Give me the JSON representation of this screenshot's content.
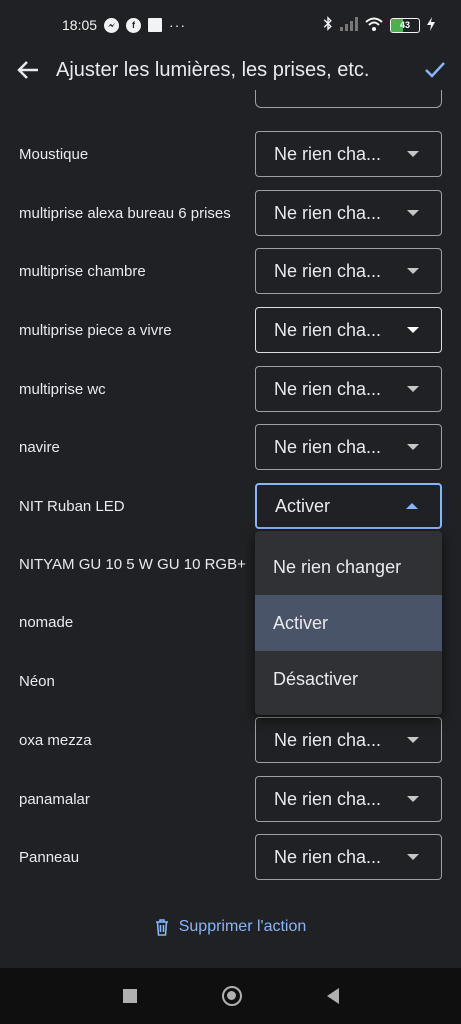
{
  "status_bar": {
    "time": "18:05",
    "dots": "···",
    "battery_level": "43",
    "battery_percent": 43
  },
  "header": {
    "title": "Ajuster les lumières, les prises, etc."
  },
  "devices": [
    {
      "label": "Moustique",
      "value": "Ne rien cha..."
    },
    {
      "label": "multiprise alexa bureau 6 prises",
      "value": "Ne rien cha..."
    },
    {
      "label": "multiprise chambre",
      "value": "Ne rien cha..."
    },
    {
      "label": "multiprise piece a vivre",
      "value": "Ne rien cha..."
    },
    {
      "label": "multiprise wc",
      "value": "Ne rien cha..."
    },
    {
      "label": "navire",
      "value": "Ne rien cha..."
    },
    {
      "label": "NIT Ruban LED",
      "value": "Activer"
    },
    {
      "label": "NITYAM GU 10 5 W GU 10 RGB+"
    },
    {
      "label": "nomade"
    },
    {
      "label": "Néon"
    },
    {
      "label": "oxa mezza",
      "value": "Ne rien cha..."
    },
    {
      "label": "panamalar",
      "value": "Ne rien cha..."
    },
    {
      "label": "Panneau",
      "value": "Ne rien cha..."
    }
  ],
  "dropdown": {
    "options": [
      "Ne rien changer",
      "Activer",
      "Désactiver"
    ],
    "selected": "Activer"
  },
  "footer": {
    "delete_label": "Supprimer l'action"
  },
  "colors": {
    "accent": "#8ab4f8",
    "background": "#202124",
    "menu_background": "#303134",
    "menu_selected": "#4a5468"
  }
}
